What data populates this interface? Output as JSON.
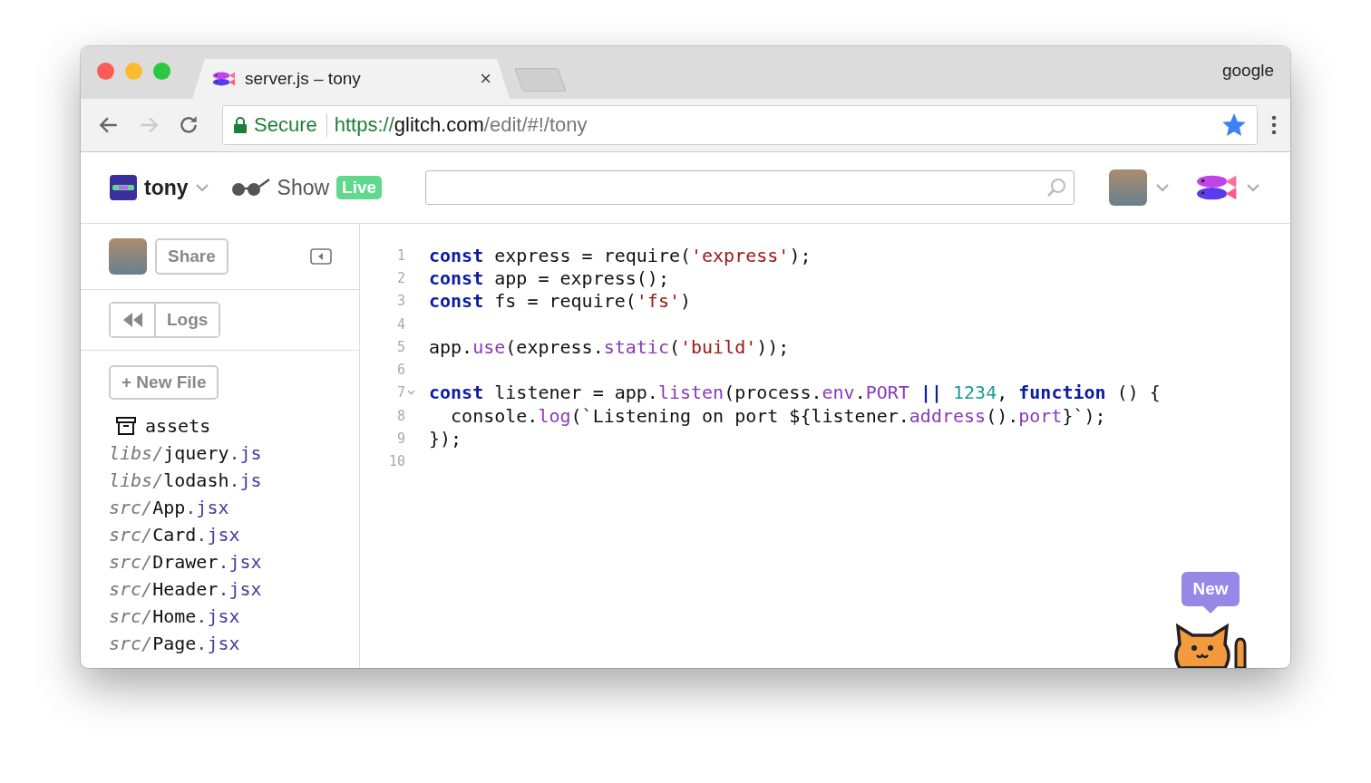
{
  "browser": {
    "tab": {
      "title": "server.js – tony",
      "close": "×"
    },
    "profile": "google",
    "nav": [
      {
        "kind": "back",
        "disabled": false
      },
      {
        "kind": "forward",
        "disabled": true
      },
      {
        "kind": "reload",
        "disabled": false
      }
    ],
    "address": {
      "security": "Secure",
      "scheme": "https://",
      "host": "glitch.com",
      "path": "/edit/#!/tony",
      "bookmarked": true
    }
  },
  "header": {
    "project": "tony",
    "show": "Show",
    "live": "Live"
  },
  "sidebar": {
    "share": "Share",
    "logs": "Logs",
    "new_file": "+ New File",
    "files": [
      {
        "kind": "folder",
        "name": "assets"
      },
      {
        "kind": "file",
        "dir": "libs/",
        "name": "jquery",
        "ext": ".js"
      },
      {
        "kind": "file",
        "dir": "libs/",
        "name": "lodash",
        "ext": ".js"
      },
      {
        "kind": "file",
        "dir": "src/",
        "name": "App",
        "ext": ".jsx"
      },
      {
        "kind": "file",
        "dir": "src/",
        "name": "Card",
        "ext": ".jsx"
      },
      {
        "kind": "file",
        "dir": "src/",
        "name": "Drawer",
        "ext": ".jsx"
      },
      {
        "kind": "file",
        "dir": "src/",
        "name": "Header",
        "ext": ".jsx"
      },
      {
        "kind": "file",
        "dir": "src/",
        "name": "Home",
        "ext": ".jsx"
      },
      {
        "kind": "file",
        "dir": "src/",
        "name": "Page",
        "ext": ".jsx"
      }
    ]
  },
  "editor": {
    "lines": [
      {
        "number": "1",
        "foldable": false,
        "tokens": [
          {
            "kind": "keyword",
            "t": "const"
          },
          {
            "kind": "plain",
            "t": " express = require("
          },
          {
            "kind": "string",
            "t": "'express'"
          },
          {
            "kind": "plain",
            "t": ");"
          }
        ]
      },
      {
        "number": "2",
        "foldable": false,
        "tokens": [
          {
            "kind": "keyword",
            "t": "const"
          },
          {
            "kind": "plain",
            "t": " app = express();"
          }
        ]
      },
      {
        "number": "3",
        "foldable": false,
        "tokens": [
          {
            "kind": "keyword",
            "t": "const"
          },
          {
            "kind": "plain",
            "t": " fs = require("
          },
          {
            "kind": "string",
            "t": "'fs'"
          },
          {
            "kind": "plain",
            "t": ")"
          }
        ]
      },
      {
        "number": "4",
        "foldable": false
      },
      {
        "number": "5",
        "foldable": false,
        "tokens": [
          {
            "kind": "plain",
            "t": "app."
          },
          {
            "kind": "property",
            "t": "use"
          },
          {
            "kind": "plain",
            "t": "(express."
          },
          {
            "kind": "property",
            "t": "static"
          },
          {
            "kind": "plain",
            "t": "("
          },
          {
            "kind": "string",
            "t": "'build'"
          },
          {
            "kind": "plain",
            "t": "));"
          }
        ]
      },
      {
        "number": "6",
        "foldable": false
      },
      {
        "number": "7",
        "foldable": true,
        "tokens": [
          {
            "kind": "keyword",
            "t": "const"
          },
          {
            "kind": "plain",
            "t": " listener = app."
          },
          {
            "kind": "property",
            "t": "listen"
          },
          {
            "kind": "plain",
            "t": "(process."
          },
          {
            "kind": "property",
            "t": "env"
          },
          {
            "kind": "plain",
            "t": "."
          },
          {
            "kind": "property",
            "t": "PORT"
          },
          {
            "kind": "keyword",
            "t": " ||"
          },
          {
            "kind": "number",
            "t": " 1234"
          },
          {
            "kind": "plain",
            "t": ", "
          },
          {
            "kind": "keyword",
            "t": "function"
          },
          {
            "kind": "plain",
            "t": " () {"
          }
        ]
      },
      {
        "number": "8",
        "foldable": false,
        "tokens": [
          {
            "kind": "plain",
            "t": "  console."
          },
          {
            "kind": "property",
            "t": "log"
          },
          {
            "kind": "plain",
            "t": "(`Listening on port ${listener."
          },
          {
            "kind": "property",
            "t": "address"
          },
          {
            "kind": "plain",
            "t": "()."
          },
          {
            "kind": "property",
            "t": "port"
          },
          {
            "kind": "plain",
            "t": "}`);"
          }
        ]
      },
      {
        "number": "9",
        "foldable": false,
        "tokens": [
          {
            "kind": "plain",
            "t": "});"
          }
        ]
      },
      {
        "number": "10",
        "foldable": false
      }
    ]
  },
  "mascot": {
    "bubble": "New"
  }
}
